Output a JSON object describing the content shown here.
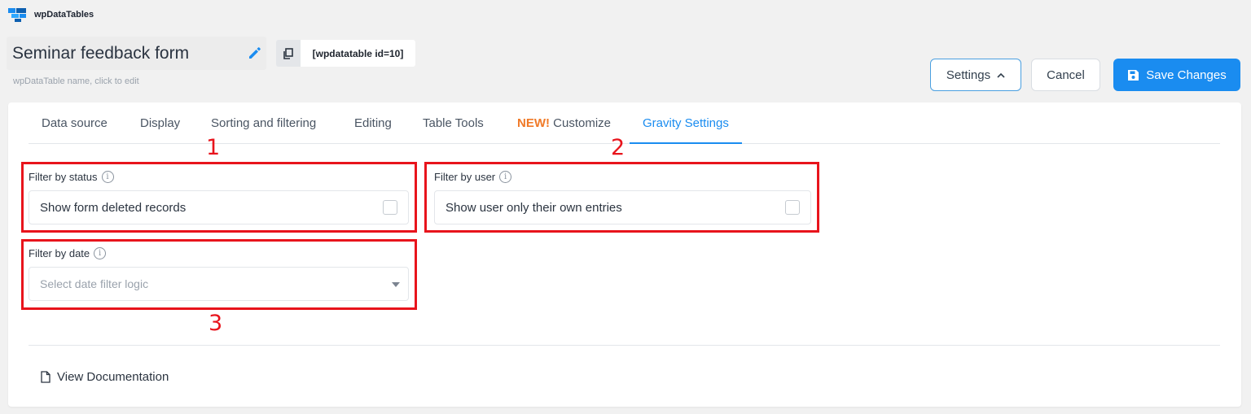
{
  "brand": {
    "name": "wpDataTables",
    "icon": "wpdatatables-logo-icon"
  },
  "header": {
    "table_name": "Seminar feedback form",
    "name_hint": "wpDataTable name, click to edit",
    "shortcode": "[wpdatatable id=10]",
    "edit_icon": "pencil-icon",
    "copy_icon": "copy-icon"
  },
  "toolbar": {
    "settings_label": "Settings",
    "cancel_label": "Cancel",
    "save_label": "Save Changes"
  },
  "tabs": [
    {
      "label": "Data source"
    },
    {
      "label": "Display"
    },
    {
      "label": "Sorting and filtering"
    },
    {
      "label": "Editing"
    },
    {
      "label": "Table Tools"
    },
    {
      "prefix": "NEW!",
      "label": "Customize"
    },
    {
      "label": "Gravity Settings",
      "active": true
    }
  ],
  "fields": {
    "status": {
      "label": "Filter by status",
      "option": "Show form deleted records",
      "checked": false
    },
    "user": {
      "label": "Filter by user",
      "option": "Show user only their own entries",
      "checked": false
    },
    "date": {
      "label": "Filter by date",
      "placeholder": "Select date filter logic"
    }
  },
  "annotations": [
    "1",
    "2",
    "3"
  ],
  "footer": {
    "doc_link": "View Documentation"
  },
  "colors": {
    "accent": "#1a8cf0",
    "new_badge": "#f07a28",
    "annotation": "#e8141c"
  }
}
